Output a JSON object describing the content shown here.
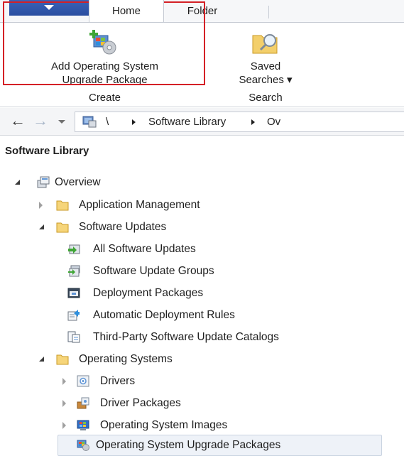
{
  "ribbon": {
    "tabs": {
      "home": "Home",
      "folder": "Folder"
    },
    "create_group": {
      "button_line1": "Add Operating System",
      "button_line2": "Upgrade Package",
      "group_label": "Create"
    },
    "search_group": {
      "button_line1": "Saved",
      "button_line2": "Searches ▾",
      "group_label": "Search"
    }
  },
  "address_bar": {
    "root": "\\",
    "crumb1": "Software Library",
    "crumb2": "Ov"
  },
  "pane": {
    "title": "Software Library",
    "overview": "Overview",
    "application_management": "Application Management",
    "software_updates": "Software Updates",
    "all_software_updates": "All Software Updates",
    "software_update_groups": "Software Update Groups",
    "deployment_packages": "Deployment Packages",
    "automatic_deployment_rules": "Automatic Deployment Rules",
    "third_party_catalogs": "Third-Party Software Update Catalogs",
    "operating_systems": "Operating Systems",
    "drivers": "Drivers",
    "driver_packages": "Driver Packages",
    "os_images": "Operating System Images",
    "os_upgrade_packages": "Operating System Upgrade Packages"
  },
  "colors": {
    "highlight": "#d42026",
    "file_tab": "#2a4ea0",
    "selection": "#eef2f8"
  }
}
